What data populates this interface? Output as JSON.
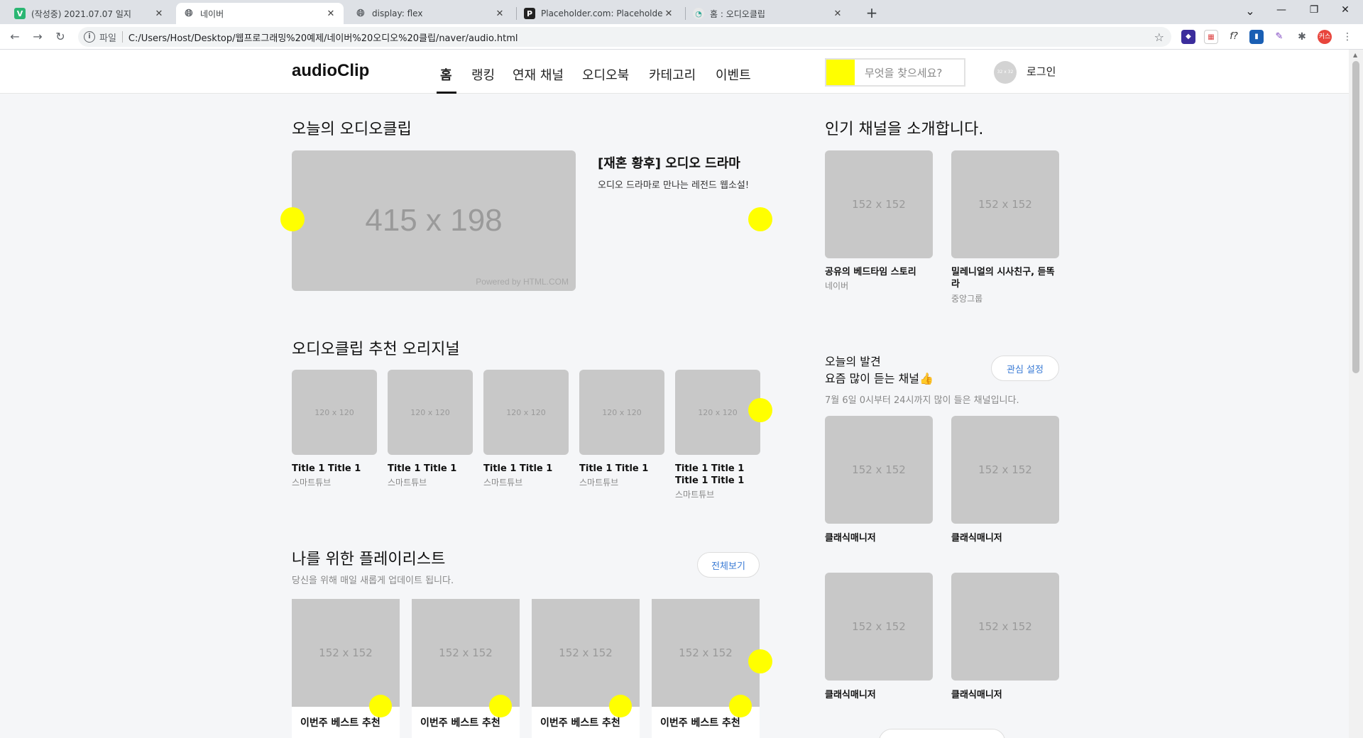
{
  "browser": {
    "tabs": [
      {
        "title": "(작성중) 2021.07.07 일지",
        "favicon": "v-icon"
      },
      {
        "title": "네이버",
        "favicon": "globe-icon"
      },
      {
        "title": "display: flex",
        "favicon": "globe-icon"
      },
      {
        "title": "Placeholder.com: Placeholder.co",
        "favicon": "p-icon"
      },
      {
        "title": "홈 : 오디오클립",
        "favicon": "audioclip-icon"
      }
    ],
    "address": {
      "scheme": "파일",
      "url": "C:/Users/Host/Desktop/웹프로그래밍%20예제/네이버%20오디오%20클립/naver/audio.html"
    },
    "profile_label": "커스"
  },
  "header": {
    "logo": "audioClip",
    "menu": [
      "홈",
      "랭킹",
      "연재 채널",
      "오디오북",
      "카테고리",
      "이벤트"
    ],
    "search_placeholder": "무엇을 찾으세요?",
    "avatar_text": "32 x 32",
    "login": "로그인"
  },
  "today": {
    "title": "오늘의 오디오클립",
    "hero_placeholder": "415 x 198",
    "powered": "Powered by HTML.COM",
    "hero_title": "[재혼 황후] 오디오 드라마",
    "hero_desc": "오디오 드라마로 만나는 레전드 웹소설!"
  },
  "originals": {
    "title": "오디오클립 추천 오리지널",
    "placeholder": "120 x 120",
    "items": [
      {
        "title": "Title 1 Title 1",
        "sub": "스마트튜브"
      },
      {
        "title": "Title 1 Title 1",
        "sub": "스마트튜브"
      },
      {
        "title": "Title 1 Title 1",
        "sub": "스마트튜브"
      },
      {
        "title": "Title 1 Title 1",
        "sub": "스마트튜브"
      },
      {
        "title": "Title 1 Title 1 Title 1 Title 1",
        "sub": "스마트튜브"
      }
    ]
  },
  "playlist": {
    "title": "나를 위한 플레이리스트",
    "subtitle": "당신을 위해 매일 새롭게 업데이트 됩니다.",
    "view_all": "전체보기",
    "placeholder": "152 x 152",
    "items": [
      "이번주 베스트 추천",
      "이번주 베스트 추천",
      "이번주 베스트 추천",
      "이번주 베스트 추천"
    ]
  },
  "popular": {
    "title": "인기 채널을 소개합니다.",
    "placeholder": "152 x 152",
    "items": [
      {
        "title": "공유의 베드타임 스토리",
        "sub": "네이버"
      },
      {
        "title": "밀레니얼의 시사친구, 듣똑라",
        "sub": "중앙그룹"
      }
    ]
  },
  "discovery": {
    "line1": "오늘의 발견",
    "line2": "요즘 많이 듣는 채널",
    "emoji": "👍",
    "interest_button": "관심 설정",
    "desc": "7월 6일 0시부터 24시까지 많이 들은 채널입니다.",
    "placeholder": "152 x 152",
    "items": [
      "클래식매니저",
      "클래식매니저",
      "클래식매니저",
      "클래식매니저"
    ]
  },
  "colors": {
    "highlight": "#ffff00",
    "link": "#3a7bd5",
    "placeholder": "#c8c8c8"
  }
}
